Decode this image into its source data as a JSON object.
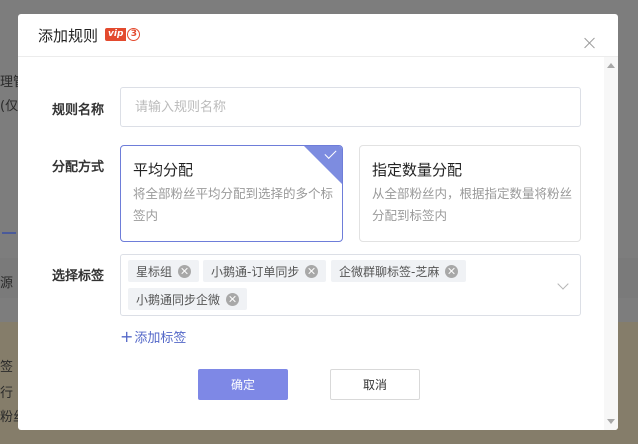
{
  "background": {
    "fragments": [
      "理管",
      "(仅",
      "源",
      "签",
      "行",
      "粉丝"
    ]
  },
  "dialog": {
    "title": "添加规则",
    "vip_label": "vip",
    "vip_level": "3",
    "rule_name": {
      "label": "规则名称",
      "placeholder": "请输入规则名称",
      "value": ""
    },
    "distribution": {
      "label": "分配方式",
      "options": [
        {
          "title": "平均分配",
          "description": "将全部粉丝平均分配到选择的多个标签内",
          "selected": true
        },
        {
          "title": "指定数量分配",
          "description": "从全部粉丝内，根据指定数量将粉丝分配到标签内",
          "selected": false
        }
      ]
    },
    "tags": {
      "label": "选择标签",
      "selected": [
        "星标组",
        "小鹅通-订单同步",
        "企微群聊标签-芝麻",
        "小鹅通同步企微"
      ],
      "add_label": "添加标签",
      "add_symbol": "+"
    },
    "buttons": {
      "confirm": "确定",
      "cancel": "取消"
    }
  },
  "colors": {
    "accent": "#7e88e6",
    "selected_border": "#6e7dd9",
    "link": "#5468c8",
    "vip": "#e34a2e"
  }
}
